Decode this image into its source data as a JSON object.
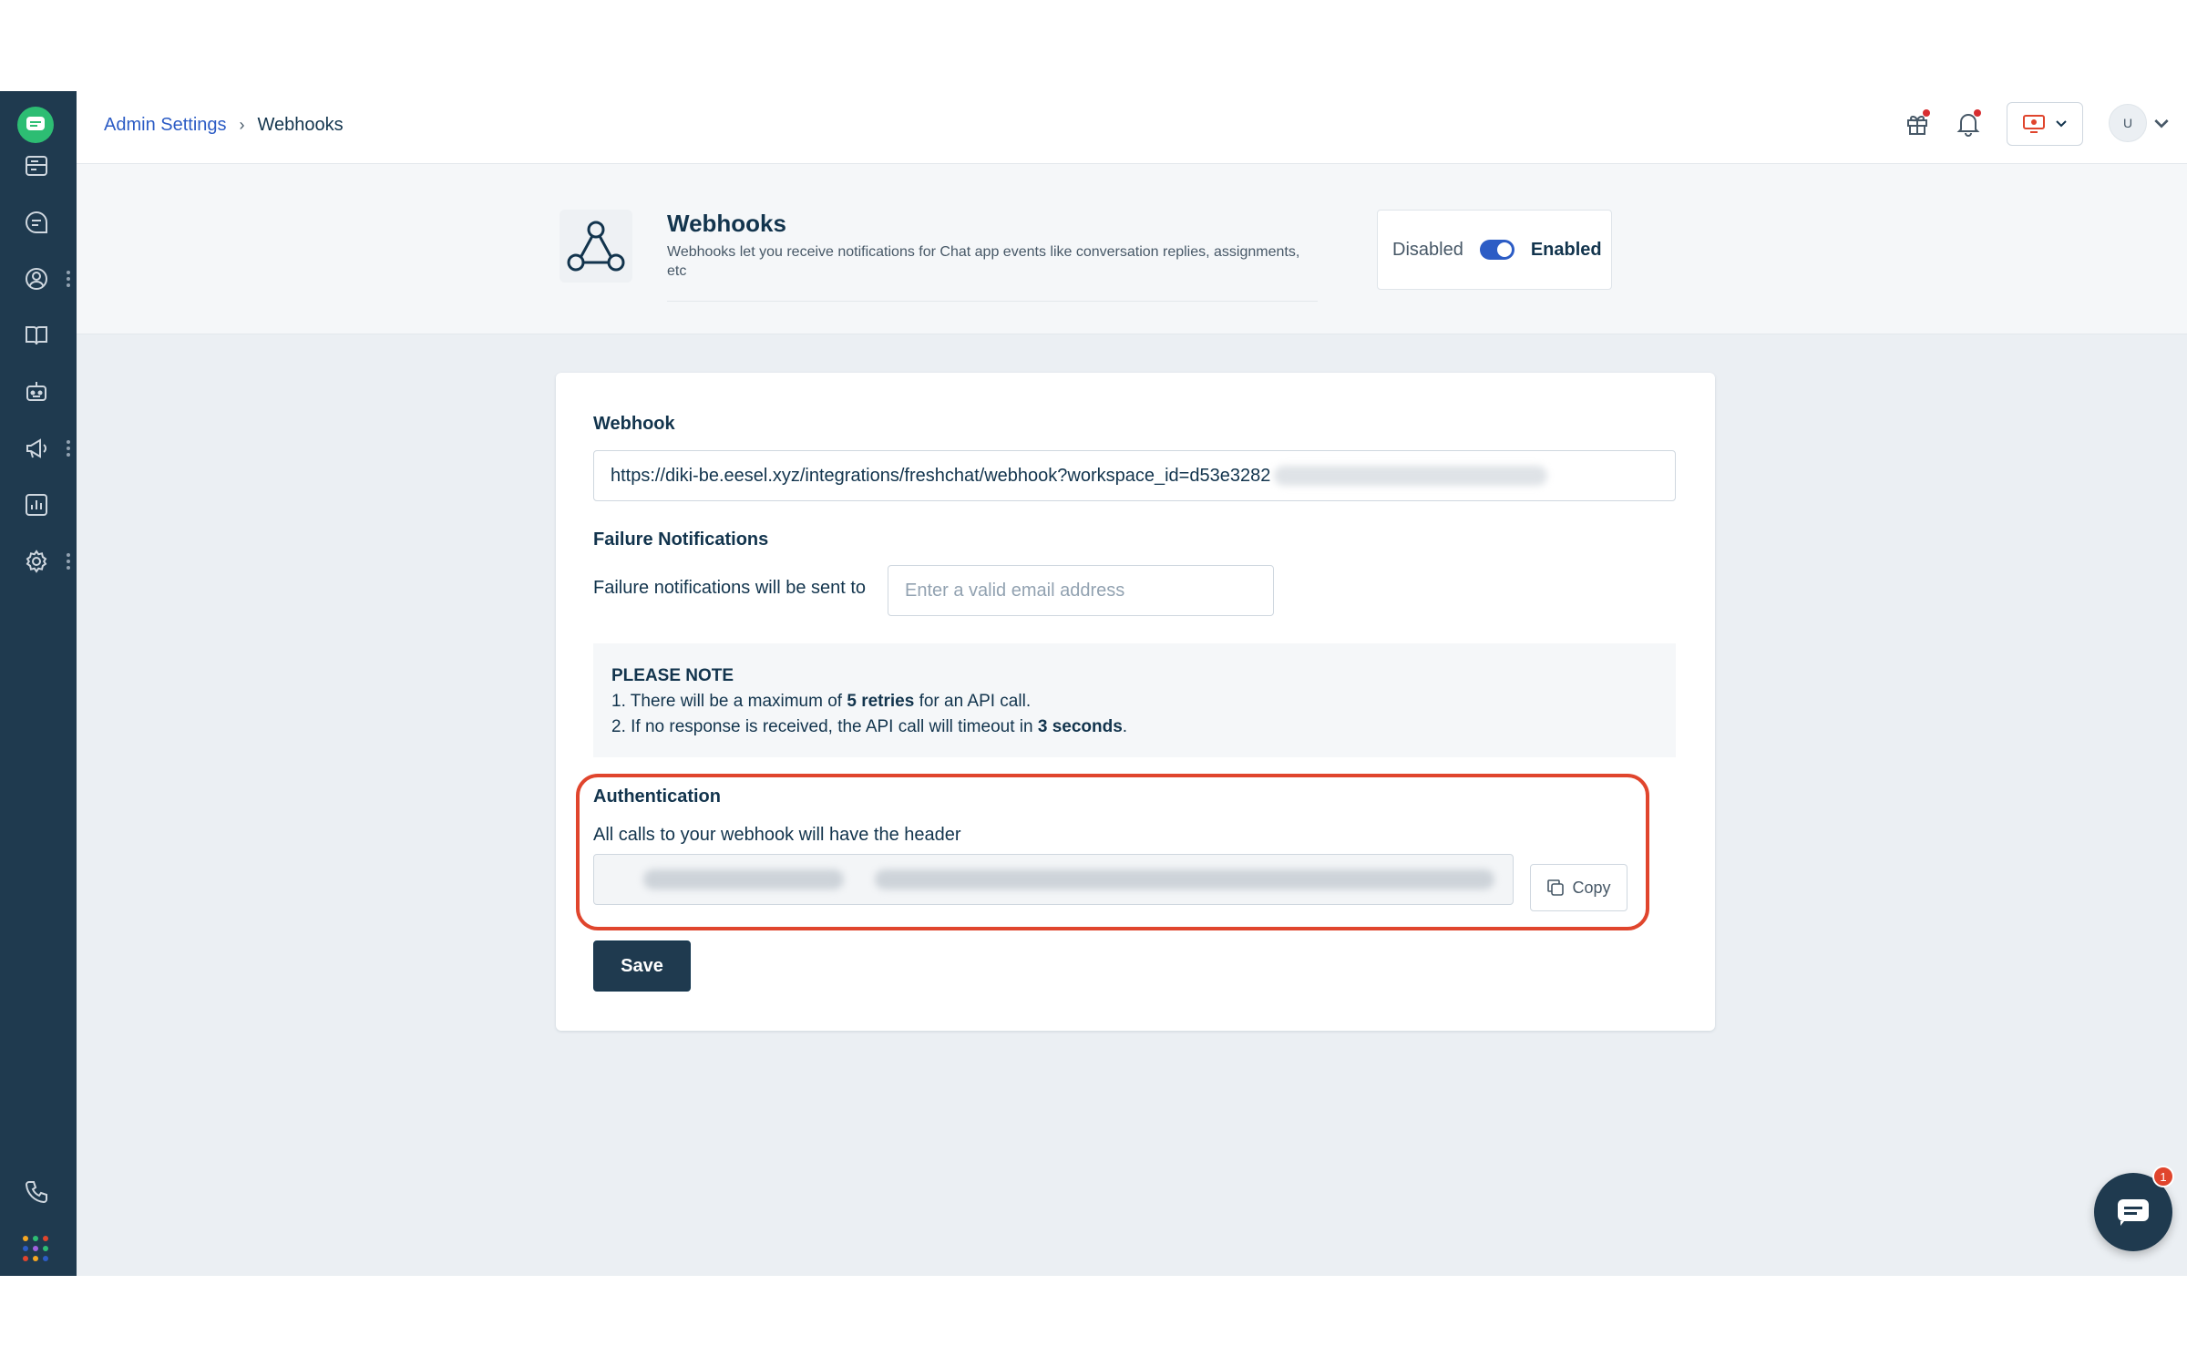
{
  "breadcrumb": {
    "parent": "Admin Settings",
    "current": "Webhooks"
  },
  "header": {
    "avatar_initial": "U",
    "has_gift_notification": true,
    "has_bell_notification": true
  },
  "sidebar": {
    "items": [
      {
        "icon": "inbox-icon",
        "has_more": false
      },
      {
        "icon": "conversations-icon",
        "has_more": false
      },
      {
        "icon": "contacts-icon",
        "has_more": true
      },
      {
        "icon": "knowledge-base-icon",
        "has_more": false
      },
      {
        "icon": "bot-icon",
        "has_more": false
      },
      {
        "icon": "campaigns-icon",
        "has_more": true
      },
      {
        "icon": "reports-icon",
        "has_more": false
      },
      {
        "icon": "settings-icon",
        "has_more": true
      }
    ],
    "bottom": [
      {
        "icon": "phone-icon"
      },
      {
        "icon": "apps-grid-icon"
      }
    ]
  },
  "page": {
    "title": "Webhooks",
    "description": "Webhooks let you receive notifications for Chat app events like conversation replies, assignments, etc",
    "toggle": {
      "off_label": "Disabled",
      "on_label": "Enabled",
      "state": "enabled"
    }
  },
  "form": {
    "webhook_label": "Webhook",
    "webhook_url": "https://diki-be.eesel.xyz/integrations/freshchat/webhook?workspace_id=d53e3282",
    "failure_title": "Failure Notifications",
    "failure_label": "Failure notifications will be sent to",
    "email_placeholder": "Enter a valid email address",
    "note": {
      "title": "PLEASE NOTE",
      "line1_prefix": "1. There will be a maximum of ",
      "line1_bold": "5 retries",
      "line1_suffix": " for an API call.",
      "line2_prefix": "2. If no response is received, the API call will timeout in ",
      "line2_bold": "3 seconds",
      "line2_suffix": "."
    },
    "auth_title": "Authentication",
    "auth_desc": "All calls to your webhook will have the header",
    "copy_label": "Copy",
    "save_label": "Save"
  },
  "chat_widget": {
    "badge_count": "1"
  },
  "colors": {
    "sidebar": "#1f3a4f",
    "accent": "#2c5cc5",
    "highlight": "#e0452d",
    "logo": "#2dbd73"
  }
}
